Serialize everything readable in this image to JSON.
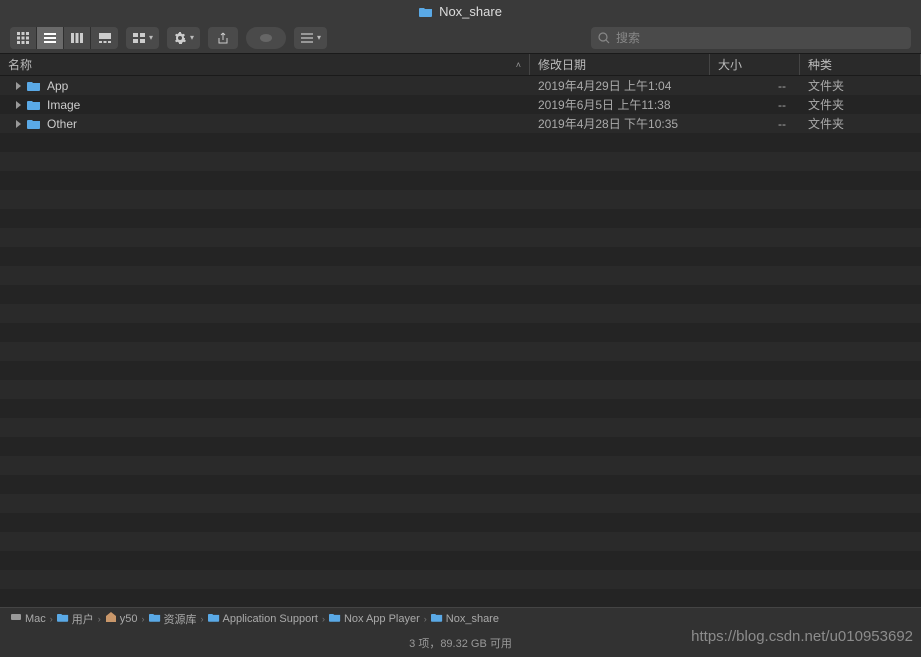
{
  "window": {
    "title": "Nox_share"
  },
  "toolbar": {
    "search_placeholder": "搜索"
  },
  "columns": {
    "name": "名称",
    "date": "修改日期",
    "size": "大小",
    "kind": "种类"
  },
  "rows": [
    {
      "name": "App",
      "date": "2019年4月29日 上午1:04",
      "size": "--",
      "kind": "文件夹"
    },
    {
      "name": "Image",
      "date": "2019年6月5日 上午11:38",
      "size": "--",
      "kind": "文件夹"
    },
    {
      "name": "Other",
      "date": "2019年4月28日 下午10:35",
      "size": "--",
      "kind": "文件夹"
    }
  ],
  "path": [
    {
      "label": "Mac",
      "icon": "disk"
    },
    {
      "label": "用户",
      "icon": "folder"
    },
    {
      "label": "y50",
      "icon": "home"
    },
    {
      "label": "资源库",
      "icon": "folder"
    },
    {
      "label": "Application Support",
      "icon": "folder"
    },
    {
      "label": "Nox App Player",
      "icon": "folder"
    },
    {
      "label": "Nox_share",
      "icon": "folder"
    }
  ],
  "status": "3 项，89.32 GB 可用",
  "watermark": "https://blog.csdn.net/u010953692"
}
